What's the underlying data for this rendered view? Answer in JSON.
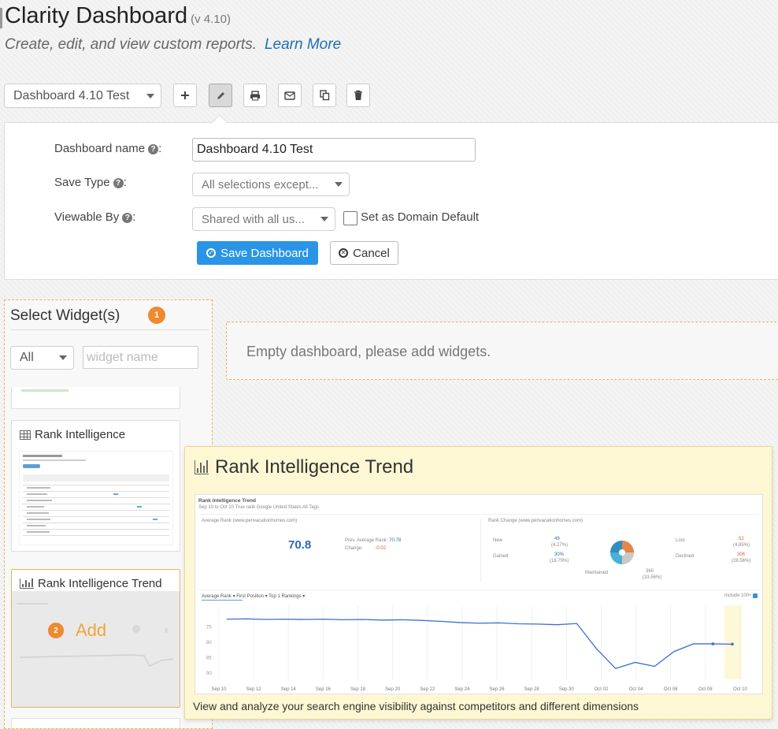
{
  "header": {
    "title": "Clarity Dashboard",
    "version": "(v 4.10)",
    "subtitle": "Create, edit, and view custom reports.",
    "learn_more": "Learn More"
  },
  "toolbar": {
    "dashboard_select": "Dashboard 4.10 Test",
    "buttons": [
      "plus-icon",
      "pencil-icon",
      "print-icon",
      "mail-icon",
      "copy-icon",
      "trash-icon"
    ]
  },
  "edit_form": {
    "name_label": "Dashboard name",
    "name_value": "Dashboard 4.10 Test",
    "save_type_label": "Save Type",
    "save_type_value": "All selections except...",
    "viewable_label": "Viewable By",
    "viewable_value": "Shared with all us...",
    "domain_default_label": "Set as Domain Default",
    "save_button": "Save Dashboard",
    "cancel_button": "Cancel",
    "colon": ":"
  },
  "widget_selector": {
    "title": "Select Widget(s)",
    "step_one": "1",
    "filter_value": "All",
    "search_placeholder": "widget name",
    "widgets": [
      {
        "name": "Rank Intelligence",
        "icon": "table-icon"
      },
      {
        "name": "Rank Intelligence Trend",
        "icon": "bar-chart-icon"
      }
    ],
    "step_two": "2",
    "add_label": "Add"
  },
  "dashboard_area": {
    "empty_message": "Empty dashboard, please add widgets."
  },
  "preview": {
    "title": "Rank Intelligence Trend",
    "description": "View and analyze your search engine visibility against competitors and different dimensions",
    "inner_title": "Rank Intelligence Trend",
    "inner_filters": "Sep 10 to Oct 10  True rank  Google  United States  All Tags",
    "avg_rank_label": "Average Rank",
    "domain": "(www.penvacationhomes.com)",
    "rank_change_label": "Rank Change",
    "avg_rank_value": "70.8",
    "prev_avg_label": "Prev. Average Rank:",
    "prev_avg_value": "70.78",
    "change_label": "Change:",
    "change_value": "-0.02",
    "new_label": "New",
    "new_value": "49",
    "new_pct": "(4.27%)",
    "gained_label": "Gained",
    "gained_value": "30%",
    "gained_pct": "(16.79%)",
    "maintained_label": "Maintained",
    "maintained_value": "360",
    "maintained_pct": "(33.56%)",
    "lost_label": "Lost",
    "lost_value": "52",
    "lost_pct": "(4.85%)",
    "declined_label": "Declined",
    "declined_value": "306",
    "declined_pct": "(28.56%)",
    "metric_tabs": "Average Rank ▾   First Position ▾   Top 1   Rankings ▾",
    "include_label": "Include 100+",
    "legend": "www.penvacationhomes.com",
    "x_ticks": [
      "Sep 10",
      "Sep 12",
      "Sep 14",
      "Sep 16",
      "Sep 18",
      "Sep 20",
      "Sep 22",
      "Sep 24",
      "Sep 26",
      "Sep 28",
      "Sep 30",
      "Oct 02",
      "Oct 04",
      "Oct 06",
      "Oct 08",
      "Oct 10"
    ],
    "y_ticks": [
      "90",
      "85",
      "80",
      "75"
    ],
    "series_values": [
      72.5,
      72.4,
      72.6,
      72.5,
      72.6,
      72.5,
      72.7,
      72.6,
      72.8,
      72.7,
      72.9,
      73.2,
      73.6,
      73.8,
      73.7,
      74.0,
      74.1,
      74.3,
      73.9,
      82.0,
      88.5,
      86.5,
      87.8,
      83.0,
      80.5,
      80.5,
      80.6
    ],
    "y_range": [
      68,
      92
    ]
  }
}
